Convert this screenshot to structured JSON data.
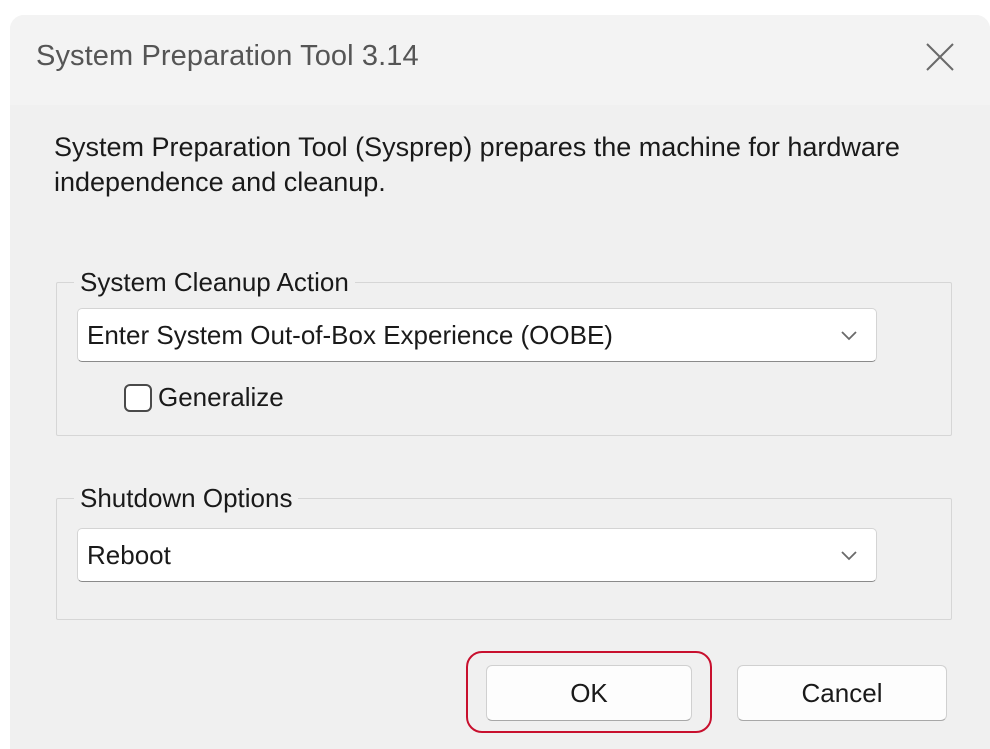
{
  "window": {
    "title": "System Preparation Tool 3.14"
  },
  "description": "System Preparation Tool (Sysprep) prepares the machine for hardware independence and cleanup.",
  "cleanup_group": {
    "legend": "System Cleanup Action",
    "selected_action": "Enter System Out-of-Box Experience (OOBE)",
    "generalize_label": "Generalize",
    "generalize_checked": false
  },
  "shutdown_group": {
    "legend": "Shutdown Options",
    "selected_option": "Reboot"
  },
  "buttons": {
    "ok_label": "OK",
    "cancel_label": "Cancel"
  },
  "icons": {
    "close": "close-icon",
    "dropdown": "chevron-down-icon"
  },
  "colors": {
    "highlight": "#c8102e",
    "dialog_bg": "#f0f0f0"
  }
}
